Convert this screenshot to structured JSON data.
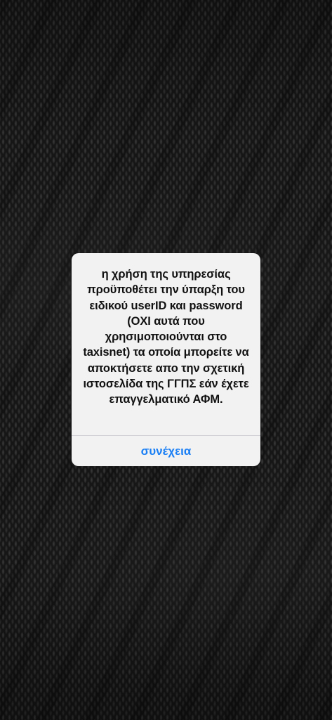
{
  "alert": {
    "message": "η χρήση της υπηρεσίας προϋποθέτει την ύπαρξη του ειδικού userID και password (ΟΧΙ αυτά που χρησιμοποιούνται στο taxisnet) τα οποία μπορείτε να αποκτήσετε απο την σχετική ιστοσελίδα της ΓΓΠΣ εάν έχετε επαγγελματικό ΑΦΜ.",
    "button_label": "συνέχεια"
  },
  "colors": {
    "background": "#161616",
    "alert_background": "#f2f2f2",
    "button_text": "#1a7ff5",
    "message_text": "#111111"
  }
}
